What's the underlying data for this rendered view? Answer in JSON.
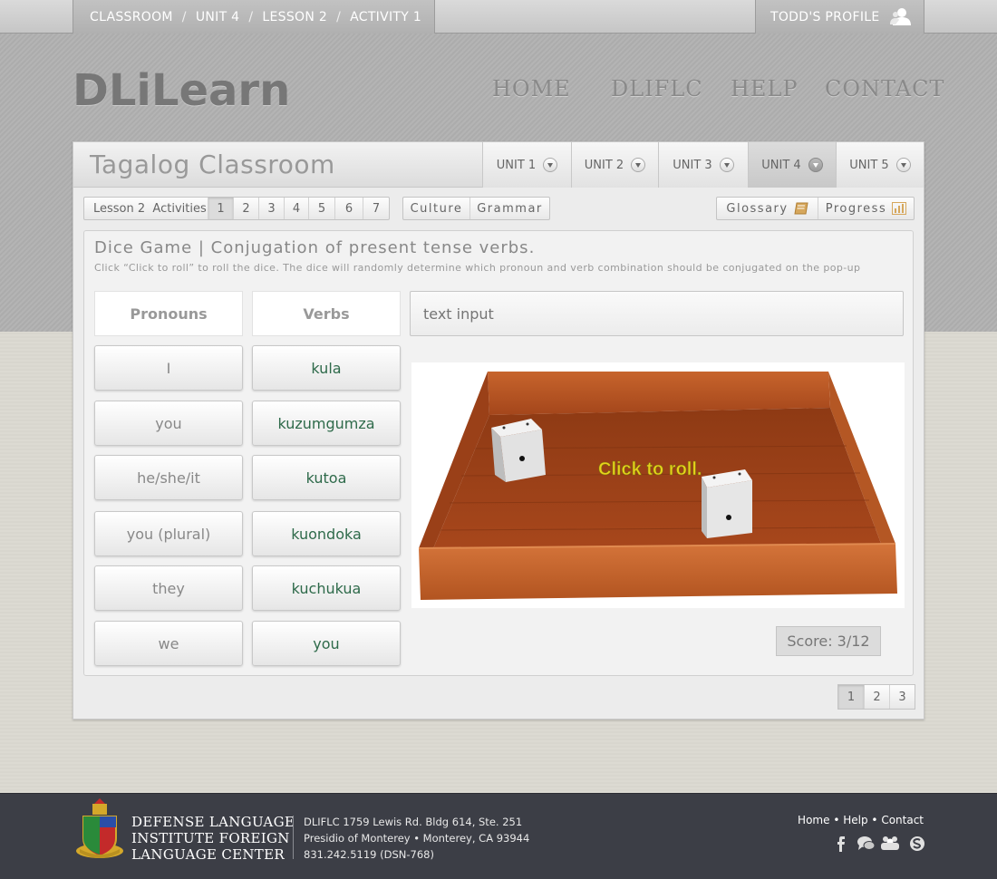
{
  "breadcrumb": [
    "CLASSROOM",
    "UNIT 4",
    "LESSON 2",
    "ACTIVITY 1"
  ],
  "breadcrumb_sep": "/",
  "profile": {
    "label": "TODD'S PROFILE",
    "icon": "user-icon"
  },
  "logo": "DLiLearn",
  "nav": [
    "HOME",
    "DLIFLC",
    "HELP",
    "CONTACT"
  ],
  "classroom_title": "Tagalog Classroom",
  "units": [
    {
      "label": "UNIT 1",
      "active": false
    },
    {
      "label": "UNIT 2",
      "active": false
    },
    {
      "label": "UNIT 3",
      "active": false
    },
    {
      "label": "UNIT 4",
      "active": true
    },
    {
      "label": "UNIT 5",
      "active": false
    }
  ],
  "lesson": {
    "label": "Lesson 2",
    "activities_label": "Activities",
    "activities": [
      "1",
      "2",
      "3",
      "4",
      "5",
      "6",
      "7"
    ],
    "selected": "1"
  },
  "extras": [
    "Culture",
    "Grammar"
  ],
  "tools": [
    {
      "label": "Glossary",
      "icon": "book-icon"
    },
    {
      "label": "Progress",
      "icon": "bar-chart-icon"
    }
  ],
  "game": {
    "title": "Dice Game | Conjugation of present tense verbs.",
    "description": "Click “Click to roll” to roll the dice. The dice will randomly determine which pronoun and verb combination should be conjugated on the pop-up",
    "pronouns_header": "Pronouns",
    "verbs_header": "Verbs",
    "pronouns": [
      "I",
      "you",
      "he/she/it",
      "you (plural)",
      "they",
      "we"
    ],
    "verbs": [
      "kula",
      "kuzumgumza",
      "kutoa",
      "kuondoka",
      "kuchukua",
      "you"
    ],
    "input_placeholder": "text input",
    "roll_label": "Click to roll.",
    "score": "Score: 3/12"
  },
  "pages": [
    "1",
    "2",
    "3"
  ],
  "footer": {
    "institution": [
      "DEFENSE LANGUAGE",
      "INSTITUTE FOREIGN",
      "LANGUAGE CENTER"
    ],
    "address": [
      "DLIFLC 1759 Lewis Rd. Bldg 614, Ste. 251",
      "Presidio of Monterey • Monterey, CA 93944",
      "831.242.5119 (DSN-768)"
    ],
    "links": [
      "Home",
      "Help",
      "Contact"
    ],
    "link_sep": "•",
    "social": [
      "facebook-icon",
      "chat-icon",
      "community-icon",
      "skype-icon"
    ]
  },
  "colors": {
    "verb_text": "#2e6a4a",
    "footer_bg": "#3c3e46",
    "roll_text": "#e6d21a",
    "tray_wood": "#a8471c"
  }
}
